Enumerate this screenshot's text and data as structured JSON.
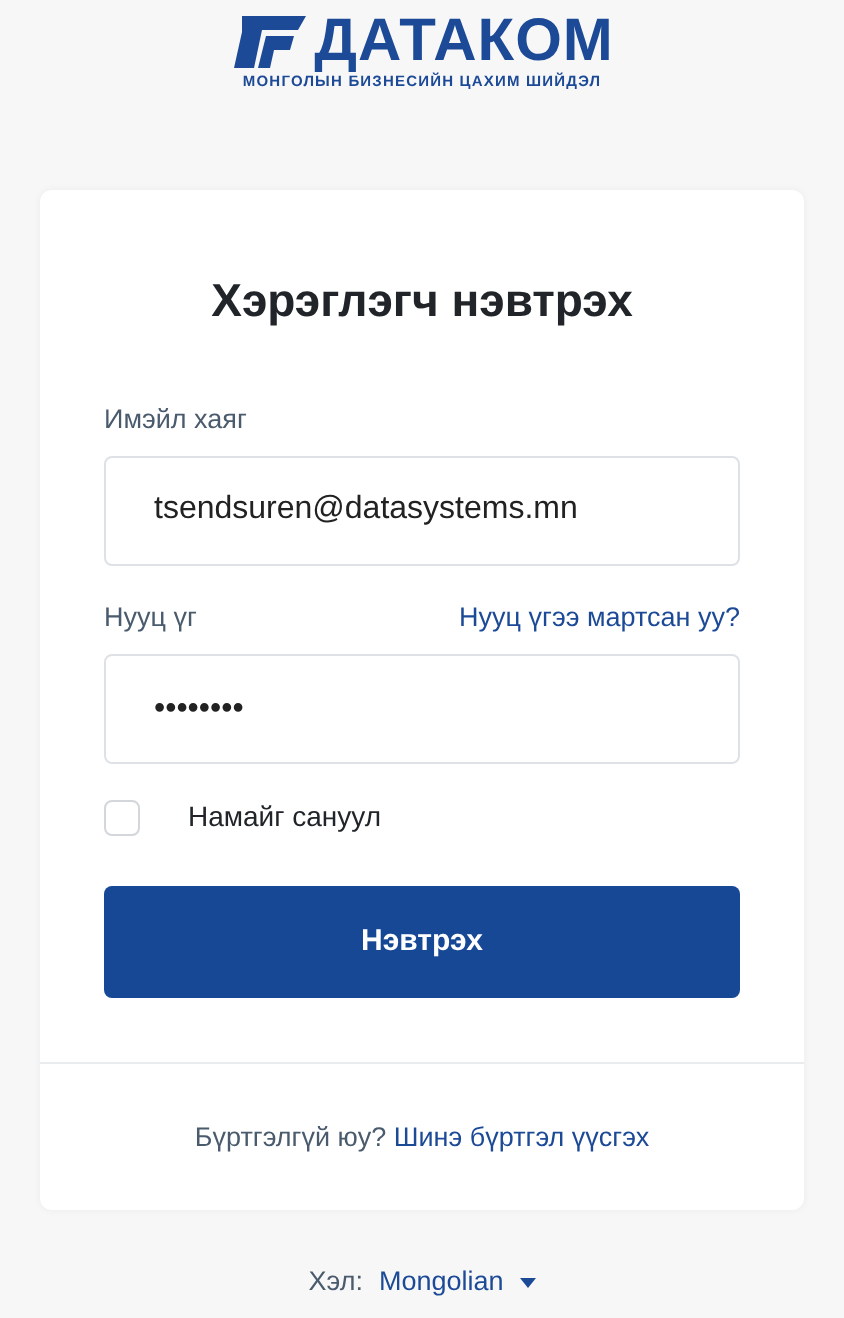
{
  "logo": {
    "name": "ДАТАКОМ",
    "tagline": "МОНГОЛЫН БИЗНЕСИЙН ЦАХИМ ШИЙДЭЛ"
  },
  "login": {
    "title": "Хэрэглэгч нэвтрэх",
    "email": {
      "label": "Имэйл хаяг",
      "value": "tsendsuren@datasystems.mn"
    },
    "password": {
      "label": "Нууц үг",
      "value": "••••••••",
      "forgot_link": "Нууц үгээ мартсан уу?"
    },
    "remember": {
      "label": "Намайг сануул",
      "checked": false
    },
    "submit": "Нэвтрэх",
    "signup": {
      "prompt": "Бүртгэлгүй юу?",
      "link": "Шинэ бүртгэл үүсгэх"
    }
  },
  "language": {
    "label": "Хэл:",
    "value": "Mongolian"
  }
}
